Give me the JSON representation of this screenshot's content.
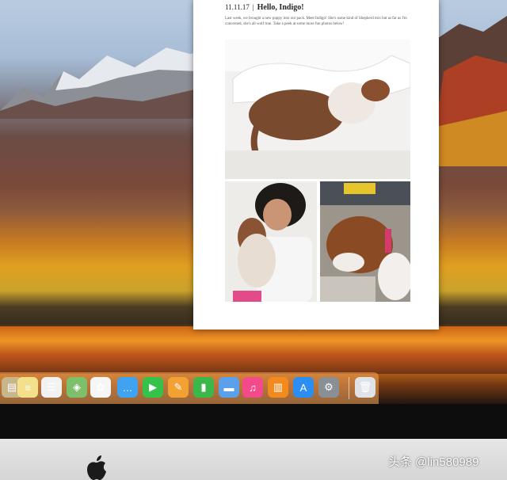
{
  "document": {
    "date": "11.11.17",
    "separator": "|",
    "title": "Hello, Indigo!",
    "body": "Last week, we brought a new puppy into our pack. Meet Indigo! She's some kind of Shepherd mix but as far as I'm concerned, she's all wolf true. Take a peek at some more fun photos below!"
  },
  "dock": {
    "items": [
      {
        "icon": "contacts-icon",
        "color": "#c9b58a",
        "glyph": "▤"
      },
      {
        "icon": "notes-icon",
        "color": "#f4e08a",
        "glyph": "≡"
      },
      {
        "icon": "reminders-icon",
        "color": "#f2f2f2",
        "glyph": "☰"
      },
      {
        "icon": "maps-icon",
        "color": "#7dbf6a",
        "glyph": "◈"
      },
      {
        "icon": "photos-icon",
        "color": "#f6f6f6",
        "glyph": "✿"
      },
      {
        "icon": "messages-icon",
        "color": "#3fa3f2",
        "glyph": "…"
      },
      {
        "icon": "facetime-icon",
        "color": "#35c24a",
        "glyph": "▶"
      },
      {
        "icon": "pages-icon",
        "color": "#f2a132",
        "glyph": "✎"
      },
      {
        "icon": "numbers-icon",
        "color": "#3cb84a",
        "glyph": "▮"
      },
      {
        "icon": "keynote-icon",
        "color": "#5aa0ea",
        "glyph": "▬"
      },
      {
        "icon": "itunes-icon",
        "color": "#f24a8a",
        "glyph": "♫"
      },
      {
        "icon": "ibooks-icon",
        "color": "#f28a1e",
        "glyph": "▥"
      },
      {
        "icon": "app-store-icon",
        "color": "#2a8ef2",
        "glyph": "A"
      },
      {
        "icon": "system-preferences-icon",
        "color": "#8a8f96",
        "glyph": "⚙"
      },
      {
        "icon": "trash-icon",
        "color": "#dfe3e8",
        "glyph": "🗑"
      }
    ]
  },
  "watermark": "头条 @lin580989"
}
